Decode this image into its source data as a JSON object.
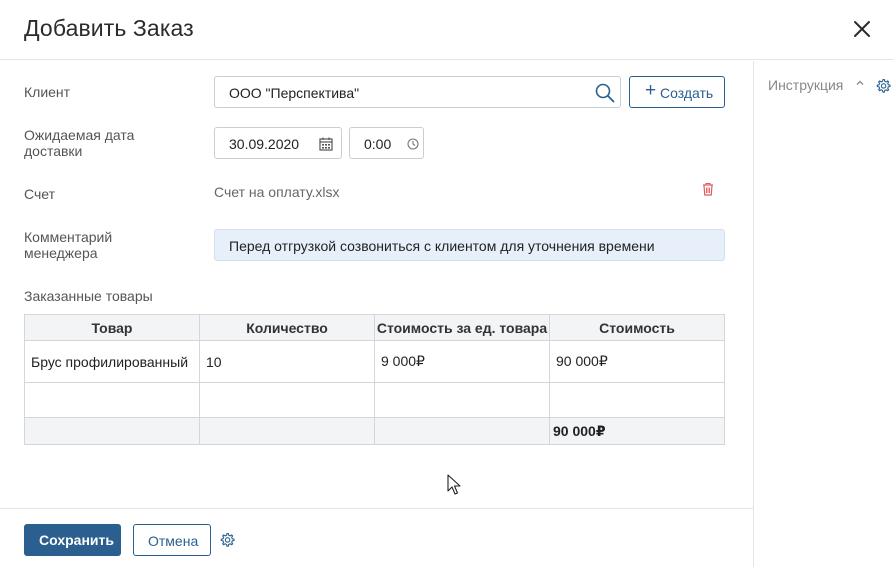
{
  "dialog": {
    "title": "Добавить Заказ"
  },
  "form": {
    "client_label": "Клиент",
    "client_value": "ООО \"Перспектива\"",
    "create_label": "Создать",
    "delivery_label_line1": "Ожидаемая дата",
    "delivery_label_line2": "доставки",
    "date_value": "30.09.2020",
    "time_value": "0:00",
    "invoice_label": "Счет",
    "invoice_file": "Счет на оплату.xlsx",
    "comment_label_line1": "Комментарий",
    "comment_label_line2": "менеджера",
    "comment_value": "Перед отгрузкой созвониться с клиентом для уточнения времени"
  },
  "goods": {
    "section_title": "Заказанные товары",
    "headers": [
      "Товар",
      "Количество",
      "Стоимость за ед. товара",
      "Стоимость"
    ],
    "rows": [
      [
        "Брус профилированный",
        "10",
        "9 000₽",
        "90 000₽"
      ],
      [
        "",
        "",
        "",
        ""
      ]
    ],
    "total": "90 000₽"
  },
  "footer": {
    "save_label": "Сохранить",
    "cancel_label": "Отмена"
  },
  "sidebar": {
    "instruction_label": "Инструкция"
  },
  "colors": {
    "accent": "#2a5f8f",
    "comment_bg": "#e7f0fa",
    "danger": "#e05a5a"
  },
  "icons": [
    "close-icon",
    "search-icon",
    "plus-icon",
    "calendar-icon",
    "clock-icon",
    "trash-icon",
    "gear-icon",
    "chevron-up-icon",
    "cursor-icon"
  ]
}
